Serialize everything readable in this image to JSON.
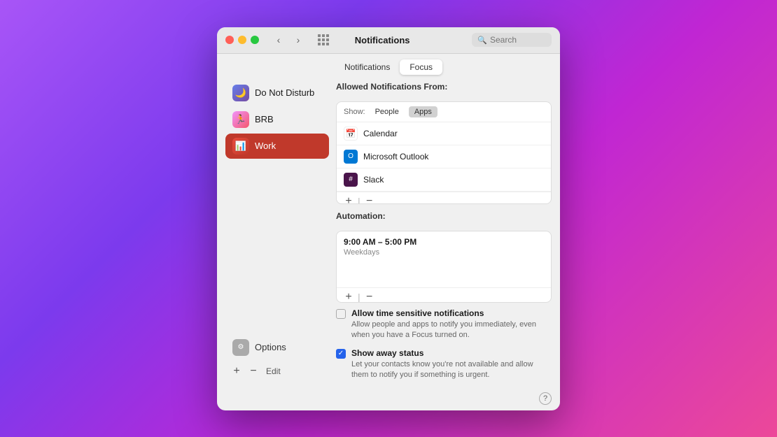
{
  "window": {
    "title": "Notifications"
  },
  "tabs": [
    {
      "id": "notifications",
      "label": "Notifications",
      "active": false
    },
    {
      "id": "focus",
      "label": "Focus",
      "active": true
    }
  ],
  "search": {
    "placeholder": "Search"
  },
  "sidebar": {
    "items": [
      {
        "id": "do-not-disturb",
        "label": "Do Not Disturb",
        "icon": "🌙",
        "iconBg": "dnd",
        "active": false
      },
      {
        "id": "brb",
        "label": "BRB",
        "icon": "🏃",
        "iconBg": "brb",
        "active": false
      },
      {
        "id": "work",
        "label": "Work",
        "icon": "📊",
        "iconBg": "work",
        "active": true
      }
    ],
    "options_label": "Options",
    "add_label": "+",
    "remove_label": "−",
    "edit_label": "Edit"
  },
  "right_panel": {
    "allowed_title": "Allowed Notifications From:",
    "show_label": "Show:",
    "show_tabs": [
      {
        "id": "people",
        "label": "People",
        "active": false
      },
      {
        "id": "apps",
        "label": "Apps",
        "active": true
      }
    ],
    "apps": [
      {
        "id": "calendar",
        "name": "Calendar",
        "icon": "📅",
        "iconBg": "calendar"
      },
      {
        "id": "outlook",
        "name": "Microsoft Outlook",
        "icon": "📧",
        "iconBg": "outlook"
      },
      {
        "id": "slack",
        "name": "Slack",
        "icon": "💬",
        "iconBg": "slack"
      }
    ],
    "automation_title": "Automation:",
    "automation": {
      "time": "9:00 AM – 5:00 PM",
      "days": "Weekdays"
    },
    "checkboxes": [
      {
        "id": "time-sensitive",
        "checked": false,
        "title": "Allow time sensitive notifications",
        "desc": "Allow people and apps to notify you immediately, even when you have a Focus turned on."
      },
      {
        "id": "show-away-status",
        "checked": true,
        "title": "Show away status",
        "desc": "Let your contacts know you're not available and allow them to notify you if something is urgent."
      }
    ],
    "help": "?"
  }
}
